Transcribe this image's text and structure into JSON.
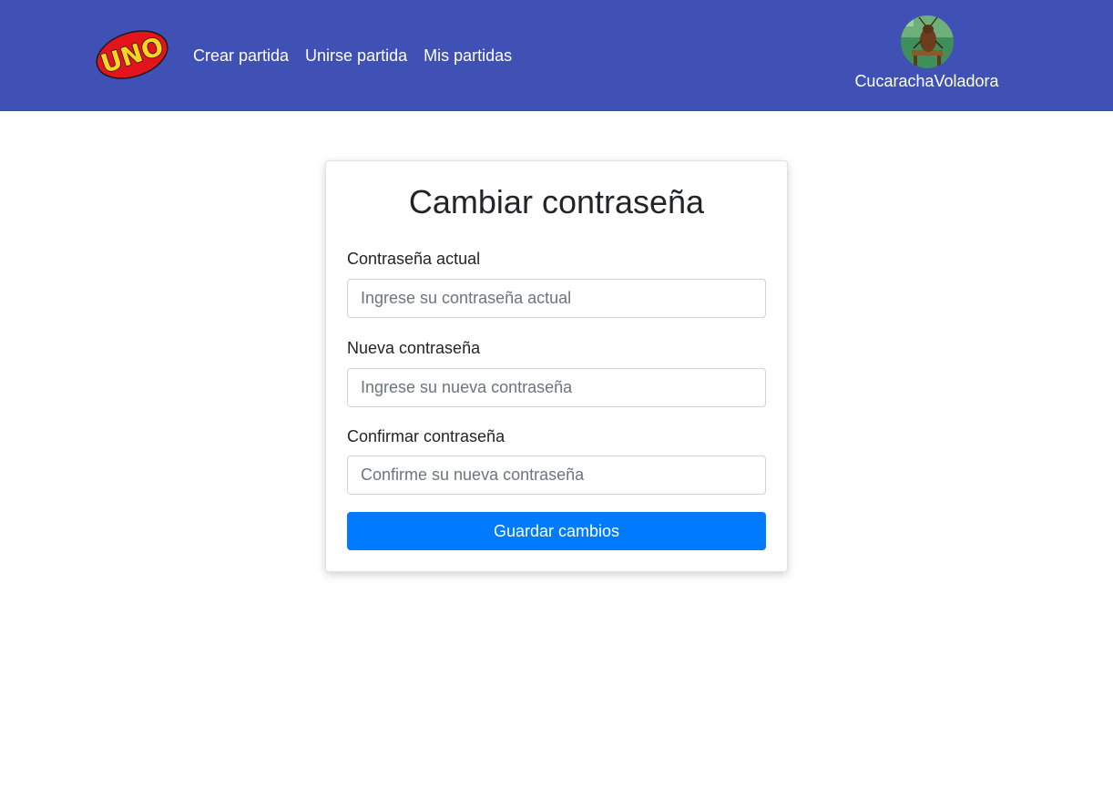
{
  "brand": {
    "logo_text": "UNO"
  },
  "nav": {
    "links": [
      {
        "label": "Crear partida"
      },
      {
        "label": "Unirse partida"
      },
      {
        "label": "Mis partidas"
      }
    ]
  },
  "user": {
    "name": "CucarachaVoladora",
    "avatar_icon": "cockroach-avatar-icon"
  },
  "form": {
    "title": "Cambiar contraseña",
    "fields": [
      {
        "label": "Contraseña actual",
        "placeholder": "Ingrese su contraseña actual",
        "value": ""
      },
      {
        "label": "Nueva contraseña",
        "placeholder": "Ingrese su nueva contraseña",
        "value": ""
      },
      {
        "label": "Confirmar contraseña",
        "placeholder": "Confirme su nueva contraseña",
        "value": ""
      }
    ],
    "submit_label": "Guardar cambios"
  },
  "colors": {
    "navbar": "#3f51b5",
    "primary": "#007bff",
    "logo_red": "#e3141b",
    "logo_yellow": "#ffd21f"
  }
}
